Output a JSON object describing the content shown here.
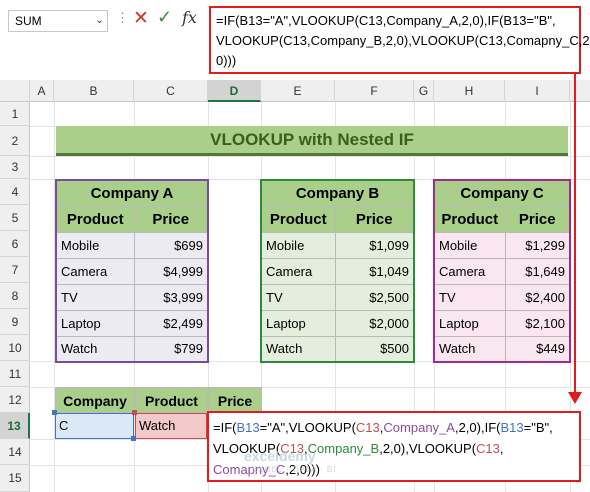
{
  "formula_bar": {
    "name_box": "SUM",
    "fx_label": "fx",
    "formula_text": "=IF(B13=\"A\",VLOOKUP(C13,Company_A,2,0),IF(B13=\"B\",\nVLOOKUP(C13,Company_B,2,0),VLOOKUP(C13,Comapny_C,2,\n0)))"
  },
  "columns": [
    "A",
    "B",
    "C",
    "D",
    "E",
    "F",
    "G",
    "H",
    "I"
  ],
  "rows": [
    "1",
    "2",
    "3",
    "4",
    "5",
    "6",
    "7",
    "8",
    "9",
    "10",
    "11",
    "12",
    "13",
    "14",
    "15"
  ],
  "title": "VLOOKUP with Nested IF",
  "tables": [
    {
      "name": "Company A",
      "headers": [
        "Product",
        "Price"
      ],
      "rows": [
        [
          "Mobile",
          "$699"
        ],
        [
          "Camera",
          "$4,999"
        ],
        [
          "TV",
          "$3,999"
        ],
        [
          "Laptop",
          "$2,499"
        ],
        [
          "Watch",
          "$799"
        ]
      ]
    },
    {
      "name": "Company B",
      "headers": [
        "Product",
        "Price"
      ],
      "rows": [
        [
          "Mobile",
          "$1,099"
        ],
        [
          "Camera",
          "$1,049"
        ],
        [
          "TV",
          "$2,500"
        ],
        [
          "Laptop",
          "$2,000"
        ],
        [
          "Watch",
          "$500"
        ]
      ]
    },
    {
      "name": "Company C",
      "headers": [
        "Product",
        "Price"
      ],
      "rows": [
        [
          "Mobile",
          "$1,299"
        ],
        [
          "Camera",
          "$1,649"
        ],
        [
          "TV",
          "$2,400"
        ],
        [
          "Laptop",
          "$2,100"
        ],
        [
          "Watch",
          "$449"
        ]
      ]
    }
  ],
  "lookup": {
    "headers": [
      "Company",
      "Product",
      "Price"
    ],
    "company": "C",
    "product": "Watch"
  },
  "cell_edit": {
    "p1": "=IF(",
    "r1": "B13",
    "p2": "=\"A\",VLOOKUP(",
    "r2": "C13",
    "p3": ",",
    "r3": "Company_A",
    "p4": ",2,0),IF(",
    "r4": "B13",
    "p5": "=\"B\",\nVLOOKUP(",
    "r5": "C13",
    "p6": ",",
    "r6": "Company_B",
    "p7": ",2,0),VLOOKUP(",
    "r7": "C13",
    "p8": ",\n",
    "r8": "Comapny_C",
    "p9": ",2,0)))"
  },
  "watermark": {
    "brand": "exceldemy",
    "tagline": "EXCEL · DATA · BI"
  },
  "colors": {
    "accent_red": "#e01c1c",
    "title_green": "#a9cf8a",
    "company_a_border": "#7a4a9e",
    "company_b_border": "#2e8b3a",
    "company_c_border": "#a32a8a"
  }
}
